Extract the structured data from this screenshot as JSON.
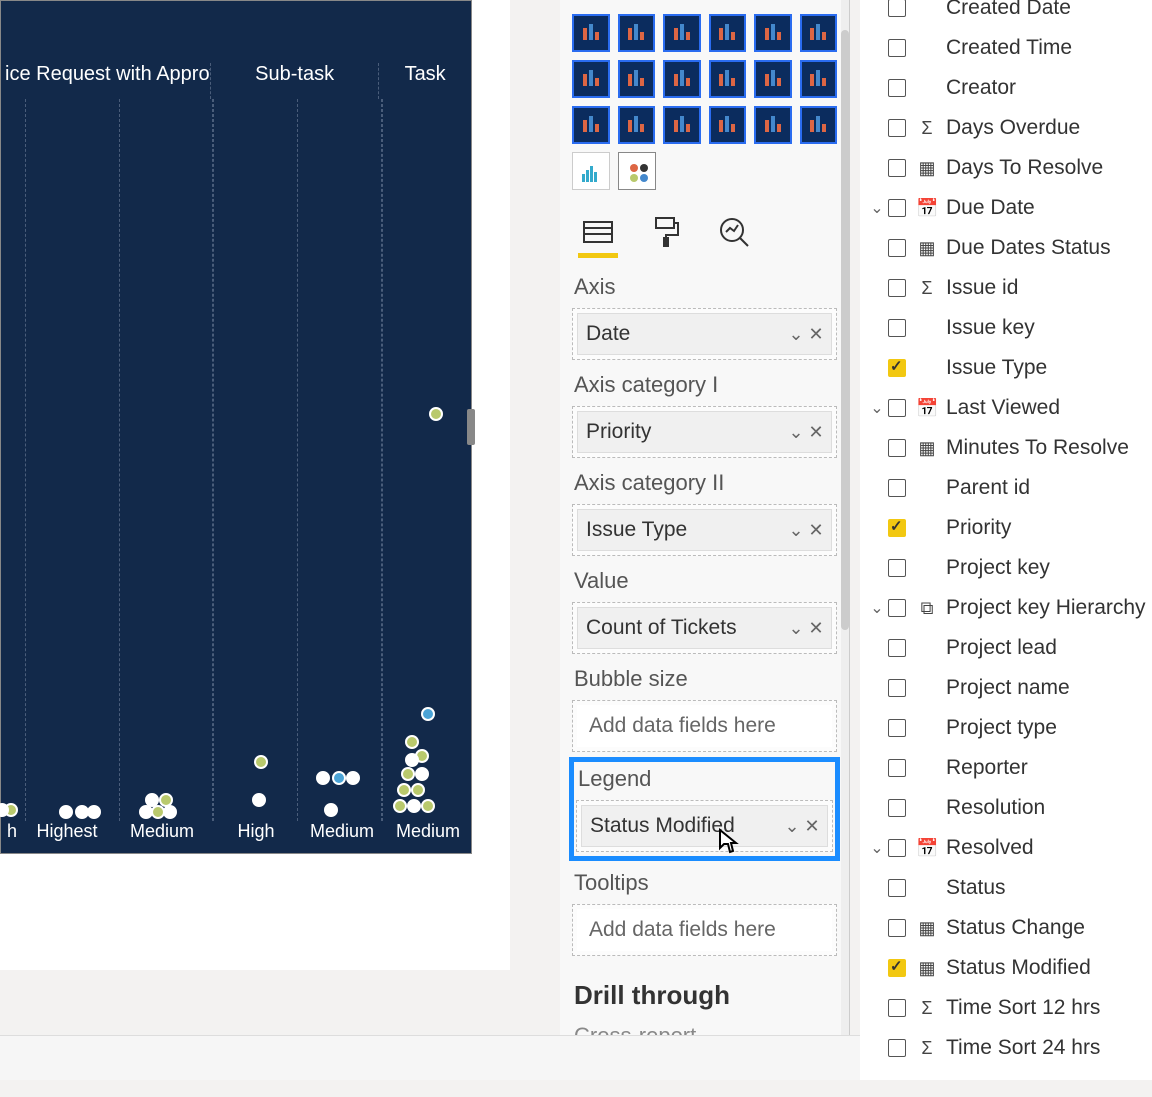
{
  "chart": {
    "headers": [
      "ice Request with Approvals",
      "Sub-task",
      "Task"
    ],
    "xlabels": [
      "h",
      "Highest",
      "Medium",
      "High",
      "Medium",
      "Medium"
    ]
  },
  "panetabs": {
    "fields": "Fields",
    "format": "Format",
    "analytics": "Analytics"
  },
  "wells": {
    "axis": {
      "label": "Axis",
      "value": "Date"
    },
    "cat1": {
      "label": "Axis category I",
      "value": "Priority"
    },
    "cat2": {
      "label": "Axis category II",
      "value": "Issue Type"
    },
    "value": {
      "label": "Value",
      "value": "Count of Tickets"
    },
    "bubble": {
      "label": "Bubble size",
      "placeholder": "Add data fields here"
    },
    "legend": {
      "label": "Legend",
      "value": "Status Modified"
    },
    "tooltips": {
      "label": "Tooltips",
      "placeholder": "Add data fields here"
    },
    "drill": "Drill through",
    "cross": "Cross-report"
  },
  "fields": [
    {
      "name": "Created Date",
      "checked": false,
      "icon": "",
      "caret": false
    },
    {
      "name": "Created Time",
      "checked": false,
      "icon": "",
      "caret": false
    },
    {
      "name": "Creator",
      "checked": false,
      "icon": "",
      "caret": false
    },
    {
      "name": "Days Overdue",
      "checked": false,
      "icon": "Σ",
      "caret": false
    },
    {
      "name": "Days To Resolve",
      "checked": false,
      "icon": "tbl",
      "caret": false
    },
    {
      "name": "Due Date",
      "checked": false,
      "icon": "cal",
      "caret": true
    },
    {
      "name": "Due Dates Status",
      "checked": false,
      "icon": "tbl",
      "caret": false
    },
    {
      "name": "Issue id",
      "checked": false,
      "icon": "Σ",
      "caret": false
    },
    {
      "name": "Issue key",
      "checked": false,
      "icon": "",
      "caret": false
    },
    {
      "name": "Issue Type",
      "checked": true,
      "icon": "",
      "caret": false
    },
    {
      "name": "Last Viewed",
      "checked": false,
      "icon": "cal",
      "caret": true
    },
    {
      "name": "Minutes To Resolve",
      "checked": false,
      "icon": "tbl",
      "caret": false
    },
    {
      "name": "Parent id",
      "checked": false,
      "icon": "",
      "caret": false
    },
    {
      "name": "Priority",
      "checked": true,
      "icon": "",
      "caret": false
    },
    {
      "name": "Project key",
      "checked": false,
      "icon": "",
      "caret": false
    },
    {
      "name": "Project key Hierarchy",
      "checked": false,
      "icon": "hier",
      "caret": true
    },
    {
      "name": "Project lead",
      "checked": false,
      "icon": "",
      "caret": false
    },
    {
      "name": "Project name",
      "checked": false,
      "icon": "",
      "caret": false
    },
    {
      "name": "Project type",
      "checked": false,
      "icon": "",
      "caret": false
    },
    {
      "name": "Reporter",
      "checked": false,
      "icon": "",
      "caret": false
    },
    {
      "name": "Resolution",
      "checked": false,
      "icon": "",
      "caret": false
    },
    {
      "name": "Resolved",
      "checked": false,
      "icon": "cal",
      "caret": true
    },
    {
      "name": "Status",
      "checked": false,
      "icon": "",
      "caret": false
    },
    {
      "name": "Status Change",
      "checked": false,
      "icon": "tbl",
      "caret": false
    },
    {
      "name": "Status Modified",
      "checked": true,
      "icon": "tbl",
      "caret": false
    },
    {
      "name": "Time Sort 12 hrs",
      "checked": false,
      "icon": "Σ",
      "caret": false
    },
    {
      "name": "Time Sort 24 hrs",
      "checked": false,
      "icon": "Σ",
      "caret": false
    }
  ],
  "chart_data": {
    "type": "scatter",
    "title": "",
    "xlabel": "",
    "ylabel": "",
    "series": [
      {
        "name": "ice Request with Approvals / h",
        "points": [
          {
            "y": 0.02
          },
          {
            "y": 0.02
          }
        ]
      },
      {
        "name": "ice Request with Approvals / Highest",
        "points": [
          {
            "y": 0.02
          },
          {
            "y": 0.02
          },
          {
            "y": 0.02
          }
        ]
      },
      {
        "name": "ice Request with Approvals / Medium",
        "points": [
          {
            "y": 0.02
          },
          {
            "y": 0.02
          },
          {
            "y": 0.02
          },
          {
            "y": 0.02
          },
          {
            "y": 0.02
          }
        ]
      },
      {
        "name": "Sub-task / High",
        "points": [
          {
            "y": 0.07
          },
          {
            "y": 0.03
          }
        ]
      },
      {
        "name": "Sub-task / Medium",
        "points": [
          {
            "y": 0.07
          },
          {
            "y": 0.07
          },
          {
            "y": 0.02
          }
        ]
      },
      {
        "name": "Task / Medium",
        "points": [
          {
            "y": 0.45
          },
          {
            "y": 0.13
          },
          {
            "y": 0.1
          },
          {
            "y": 0.08
          },
          {
            "y": 0.08
          },
          {
            "y": 0.07
          },
          {
            "y": 0.05
          },
          {
            "y": 0.04
          },
          {
            "y": 0.03
          },
          {
            "y": 0.02
          },
          {
            "y": 0.02
          }
        ]
      }
    ]
  }
}
